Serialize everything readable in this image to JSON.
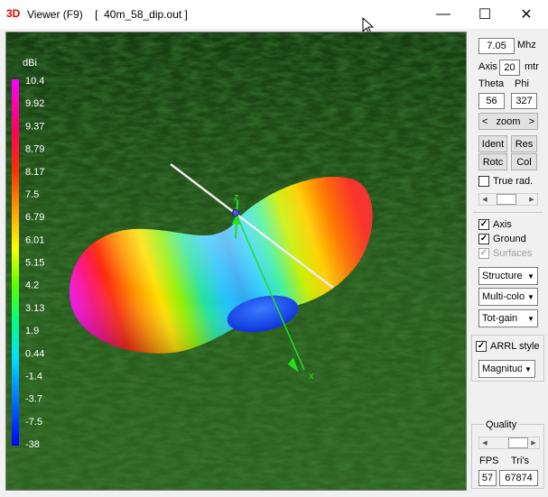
{
  "window": {
    "app_icon": "3D",
    "title": "Viewer (F9)    [  40m_58_dip.out ]",
    "minimize": "—",
    "maximize": "☐",
    "close": "✕"
  },
  "legend": {
    "unit": "dBi",
    "ticks": [
      "10.4",
      "9.92",
      "9.37",
      "8.79",
      "8.17",
      "7.5",
      "6.79",
      "6.01",
      "5.15",
      "4.2",
      "3.13",
      "1.9",
      "0.44",
      "-1.4",
      "-3.7",
      "-7.5",
      "-38"
    ]
  },
  "viewport": {
    "z_axis_label": "z",
    "x_axis_label": "x",
    "ground_color": "#2a5a1e",
    "axis_color": "#1ee01e",
    "wire_color": "#e8e8e8"
  },
  "panel": {
    "freq_value": "7.05",
    "freq_unit": "Mhz",
    "axis_label": "Axis",
    "axis_value": "20",
    "axis_unit": "mtr",
    "theta_label": "Theta",
    "phi_label": "Phi",
    "theta_value": "56",
    "phi_value": "327",
    "zoom_left": "<",
    "zoom_label": "zoom",
    "zoom_right": ">",
    "ident_label": "Ident",
    "res_label": "Res",
    "rotc_label": "Rotc",
    "col_label": "Col",
    "true_rad_label": "True rad.",
    "true_rad_checked": false,
    "true_rad_slider": 0.45,
    "axis_check_label": "Axis",
    "axis_checked": true,
    "ground_check_label": "Ground",
    "ground_checked": true,
    "surfaces_check_label": "Surfaces",
    "surfaces_checked": true,
    "structure_select": "Structure",
    "multicolor_select": "Multi-color",
    "totgain_select": "Tot-gain",
    "arrl_label": "ARRL style",
    "arrl_checked": true,
    "magnitude_select": "Magnitude",
    "quality_label": "Quality",
    "quality_slider": 0.75,
    "fps_label": "FPS",
    "tris_label": "Tri's",
    "fps_value": "57",
    "tris_value": "67874"
  }
}
